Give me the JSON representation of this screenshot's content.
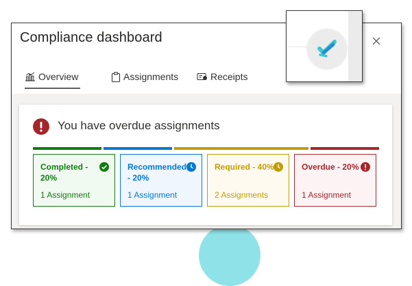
{
  "dialog": {
    "title": "Compliance dashboard",
    "close_icon": "close-icon"
  },
  "tabs": [
    {
      "label": "Overview",
      "icon": "chart-icon",
      "active": true
    },
    {
      "label": "Assignments",
      "icon": "clipboard-icon",
      "active": false
    },
    {
      "label": "Receipts",
      "icon": "receipt-icon",
      "active": false
    }
  ],
  "alert": {
    "text": "You have overdue assignments",
    "icon": "error-icon",
    "color": "#a4262c"
  },
  "statuses": [
    {
      "title": "Completed - 20%",
      "count": "1 Assignment",
      "icon": "check-circle-icon",
      "color": "#107c10",
      "bg": "#f1faf1",
      "percent": 20
    },
    {
      "title": "Recommended - 20%",
      "count": "1 Assignment",
      "icon": "clock-icon",
      "color": "#0078d4",
      "bg": "#eff6fc",
      "percent": 20
    },
    {
      "title": "Required - 40%",
      "count": "2 Assignments",
      "icon": "clock-icon",
      "color": "#c19c00",
      "bg": "#fffaf0",
      "percent": 40
    },
    {
      "title": "Overdue - 20%",
      "count": "1 Assignment",
      "icon": "error-icon",
      "color": "#a4262c",
      "bg": "#fdf3f4",
      "percent": 20
    }
  ],
  "app_logo": {
    "icon": "app-logo-icon"
  }
}
